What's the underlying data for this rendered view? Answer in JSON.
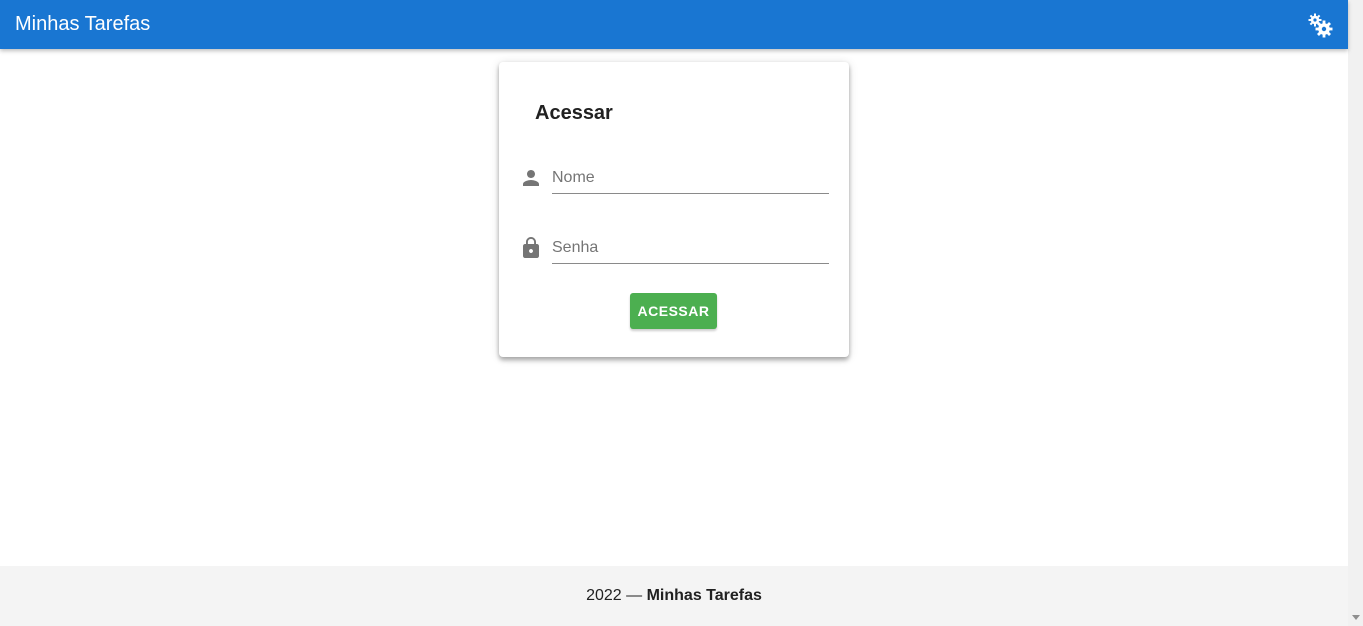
{
  "appbar": {
    "title": "Minhas Tarefas",
    "settings_icon": "gears-icon",
    "color": "#1976d2"
  },
  "login": {
    "title": "Acessar",
    "name_field": {
      "placeholder": "Nome",
      "value": "",
      "icon": "person-icon"
    },
    "password_field": {
      "placeholder": "Senha",
      "value": "",
      "icon": "lock-icon"
    },
    "submit_label": "ACESSAR",
    "submit_color": "#4caf50"
  },
  "footer": {
    "year": "2022",
    "separator": " — ",
    "brand": "Minhas Tarefas"
  }
}
